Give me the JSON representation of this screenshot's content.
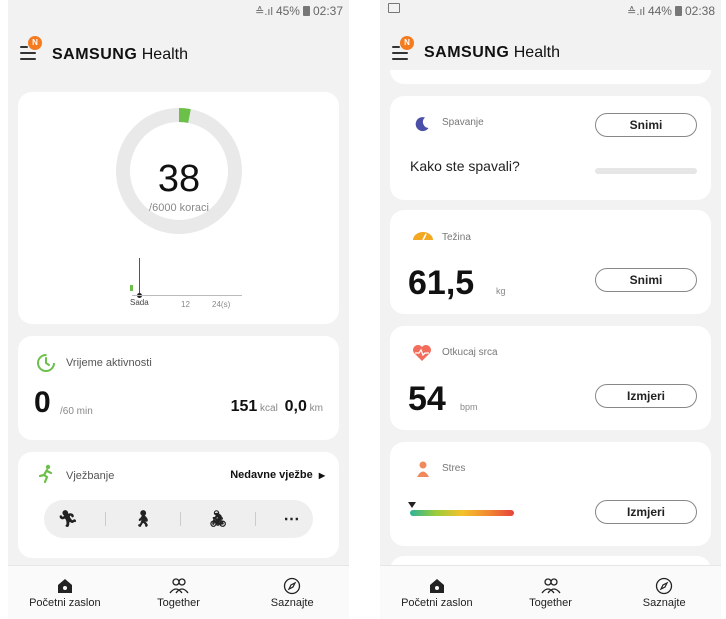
{
  "left_phone": {
    "status": {
      "signal": "≐.❙l",
      "battery_pct": "45%",
      "time": "02:37"
    },
    "app": {
      "brand_bold": "SAMSUNG",
      "brand_light": "Health",
      "notif_badge": "N"
    },
    "steps": {
      "count": "38",
      "goal": "/6000 koraci",
      "progress_fraction": 0.0063,
      "axis_labels": [
        "Sada",
        "12",
        "24(s)"
      ]
    },
    "activity": {
      "title": "Vrijeme aktivnosti",
      "value": "0",
      "unit": "/60 min",
      "kcal_value": "151",
      "kcal_unit": "kcal",
      "km_value": "0,0",
      "km_unit": "km"
    },
    "exercise": {
      "title": "Vježbanje",
      "recent": "Nedavne vježbe",
      "more": "⋯"
    },
    "nav": [
      {
        "label": "Početni zaslon",
        "icon": "home-icon"
      },
      {
        "label": "Together",
        "icon": "people-icon"
      },
      {
        "label": "Saznajte",
        "icon": "compass-icon"
      }
    ]
  },
  "right_phone": {
    "status": {
      "signal": "≐.❙l",
      "battery_pct": "44%",
      "time": "02:38"
    },
    "app": {
      "brand_bold": "SAMSUNG",
      "brand_light": "Health",
      "notif_badge": "N"
    },
    "sleep": {
      "title": "Spavanje",
      "button": "Snimi",
      "question": "Kako ste spavali?"
    },
    "weight": {
      "title": "Težina",
      "value": "61,5",
      "unit": "kg",
      "button": "Snimi"
    },
    "heart": {
      "title": "Otkucaj srca",
      "value": "54",
      "unit": "bpm",
      "button": "Izmjeri"
    },
    "stress": {
      "title": "Stres",
      "button": "Izmjeri",
      "level_fraction": 0.0
    },
    "nav": [
      {
        "label": "Početni zaslon",
        "icon": "home-icon"
      },
      {
        "label": "Together",
        "icon": "people-icon"
      },
      {
        "label": "Saznajte",
        "icon": "compass-icon"
      }
    ]
  },
  "colors": {
    "accent_orange": "#f47b20",
    "step_green": "#6cc04a",
    "sleep_purple": "#4b4fa8",
    "weight_yellow": "#f4a821",
    "heart_coral": "#f26d5b",
    "stress_orange": "#f08a5d"
  }
}
